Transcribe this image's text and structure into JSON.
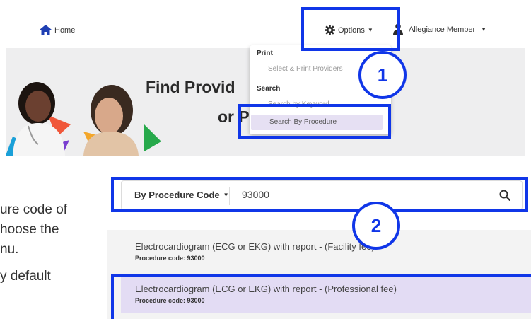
{
  "nav": {
    "home_label": "Home",
    "options_label": "Options",
    "member_label": "Allegiance Member"
  },
  "hero": {
    "title_line1": "Find Provid",
    "title_line2": "or P"
  },
  "options_menu": {
    "print_header": "Print",
    "print_item": "Select & Print Providers",
    "search_header": "Search",
    "keyword_item": "Search by Keyword",
    "procedure_item": "Search By Procedure"
  },
  "paragraph": {
    "line1": "ure code of",
    "line2": "hoose the",
    "line3": "nu.",
    "line4": "y default"
  },
  "search": {
    "mode_label": "By Procedure Code",
    "query": "93000"
  },
  "results": [
    {
      "title": "Electrocardiogram (ECG or EKG) with report - (Facility fee)",
      "code_label": "Procedure code: 93000"
    },
    {
      "title": "Electrocardiogram (ECG or EKG) with report - (Professional fee)",
      "code_label": "Procedure code: 93000"
    }
  ],
  "annotations": {
    "step1": "1",
    "step2": "2",
    "color": "#1036e8"
  },
  "icons": {
    "home": "home-icon",
    "options": "gear-icon",
    "member": "user-icon",
    "search": "search-icon",
    "dropdown": "chevron-down-icon"
  }
}
